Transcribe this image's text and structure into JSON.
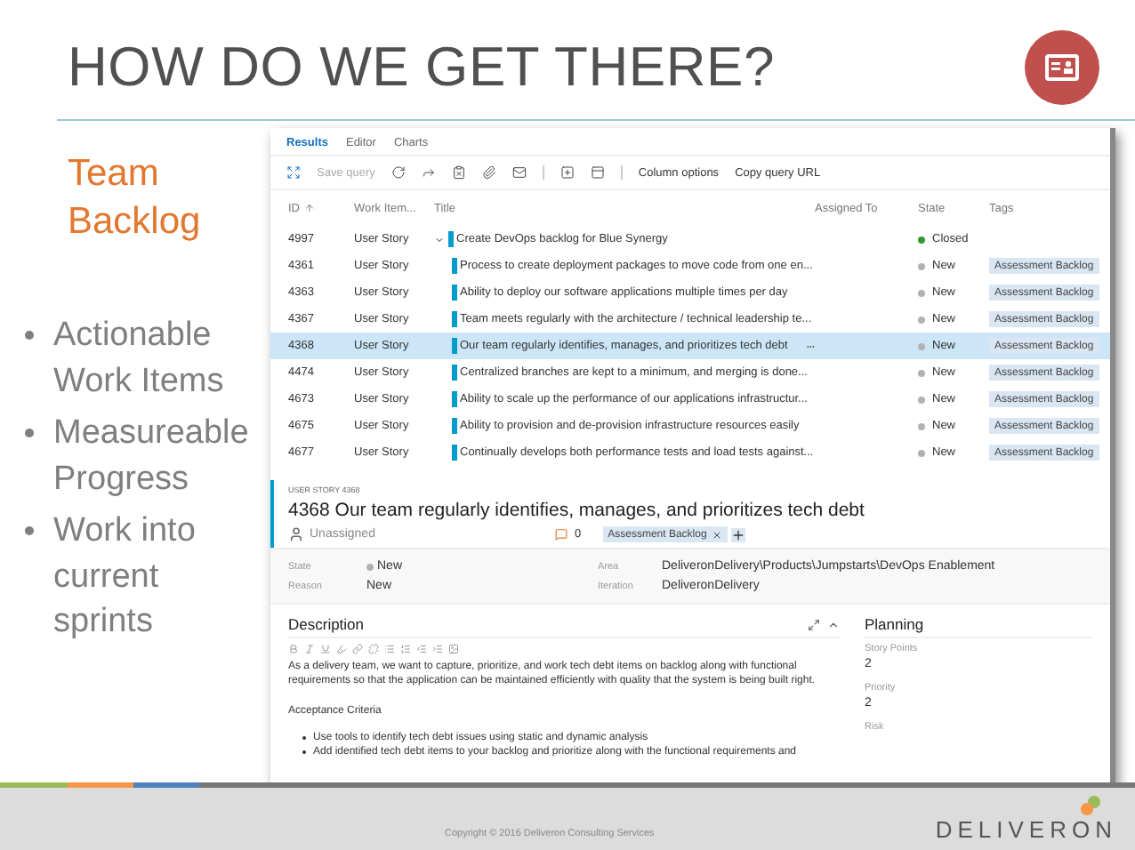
{
  "slide": {
    "title": "HOW DO WE GET THERE?",
    "subtitle_lines": [
      "Team",
      "Backlog"
    ],
    "bullets": [
      [
        "Actionable",
        "Work Items"
      ],
      [
        "Measureable",
        "Progress"
      ],
      [
        "Work into",
        "current",
        "sprints"
      ]
    ],
    "copyright": "Copyright © 2016 Deliveron Consulting Services",
    "logo_text": "DELIVERON"
  },
  "app": {
    "tabs": [
      {
        "label": "Results",
        "selected": true
      },
      {
        "label": "Editor",
        "selected": false
      },
      {
        "label": "Charts",
        "selected": false
      }
    ],
    "toolbar": {
      "save_query": {
        "label": "Save query",
        "disabled": true
      },
      "column_options": "Column options",
      "copy_url": "Copy query URL"
    },
    "columns": [
      "ID",
      "Work Item...",
      "Title",
      "Assigned To",
      "State",
      "Tags"
    ],
    "rows": [
      {
        "id": "4997",
        "type": "User Story",
        "title": "Create DevOps backlog for Blue Synergy",
        "state": "Closed",
        "color": "#339933",
        "selected": false,
        "expanded": true,
        "children": [
          {
            "id": "4361",
            "type": "User Story",
            "title": "Process to create deployment packages to move code from one en...",
            "state": "New",
            "color": "#b2b2b2",
            "tag": "Assessment Backlog",
            "selected": false
          },
          {
            "id": "4363",
            "type": "User Story",
            "title": "Ability to deploy our software applications multiple times per day",
            "state": "New",
            "color": "#b2b2b2",
            "tag": "Assessment Backlog",
            "selected": false
          },
          {
            "id": "4367",
            "type": "User Story",
            "title": "Team meets regularly with the architecture / technical leadership te...",
            "state": "New",
            "color": "#b2b2b2",
            "tag": "Assessment Backlog",
            "selected": false
          },
          {
            "id": "4368",
            "type": "User Story",
            "title": "Our team regularly identifies, manages, and prioritizes tech debt",
            "state": "New",
            "color": "#b2b2b2",
            "tag": "Assessment Backlog",
            "selected": true
          },
          {
            "id": "4474",
            "type": "User Story",
            "title": "Centralized branches are kept to a minimum, and merging is done...",
            "state": "New",
            "color": "#b2b2b2",
            "tag": "Assessment Backlog",
            "selected": false
          },
          {
            "id": "4673",
            "type": "User Story",
            "title": "Ability to scale up the performance of our applications infrastructur...",
            "state": "New",
            "color": "#b2b2b2",
            "tag": "Assessment Backlog",
            "selected": false
          },
          {
            "id": "4675",
            "type": "User Story",
            "title": "Ability to provision and de-provision infrastructure resources easily",
            "state": "New",
            "color": "#b2b2b2",
            "tag": "Assessment Backlog",
            "selected": false
          },
          {
            "id": "4677",
            "type": "User Story",
            "title": "Continually develops both performance tests and load tests against...",
            "state": "New",
            "color": "#b2b2b2",
            "tag": "Assessment Backlog",
            "selected": false
          }
        ]
      }
    ],
    "detail": {
      "kind_label": "USER STORY 4368",
      "id": "4368",
      "title": "Our team regularly identifies, manages, and prioritizes tech debt",
      "assignee": "Unassigned",
      "comments": "0",
      "tag": "Assessment Backlog",
      "fields": [
        {
          "label": "State",
          "value": "New",
          "color": "#b2b2b2"
        },
        {
          "label": "Area",
          "value": "DeliveronDelivery\\Products\\Jumpstarts\\DevOps Enablement"
        },
        {
          "label": "Reason",
          "value": "New"
        },
        {
          "label": "Iteration",
          "value": "DeliveronDelivery"
        }
      ],
      "description": {
        "heading": "Description",
        "paragraph": "As a delivery team, we want to capture, prioritize, and work tech debt items on backlog along with functional requirements so that the application can be maintained efficiently with quality that the system is being built right.",
        "criteria_heading": "Acceptance Criteria",
        "criteria": [
          "Use tools to identify tech debt issues using static and dynamic analysis",
          "Add identified tech debt items to your backlog and prioritize along with the functional requirements and"
        ]
      },
      "planning": {
        "heading": "Planning",
        "fields": [
          {
            "label": "Story Points",
            "value": "2"
          },
          {
            "label": "Priority",
            "value": "2"
          },
          {
            "label": "Risk"
          }
        ]
      }
    }
  }
}
